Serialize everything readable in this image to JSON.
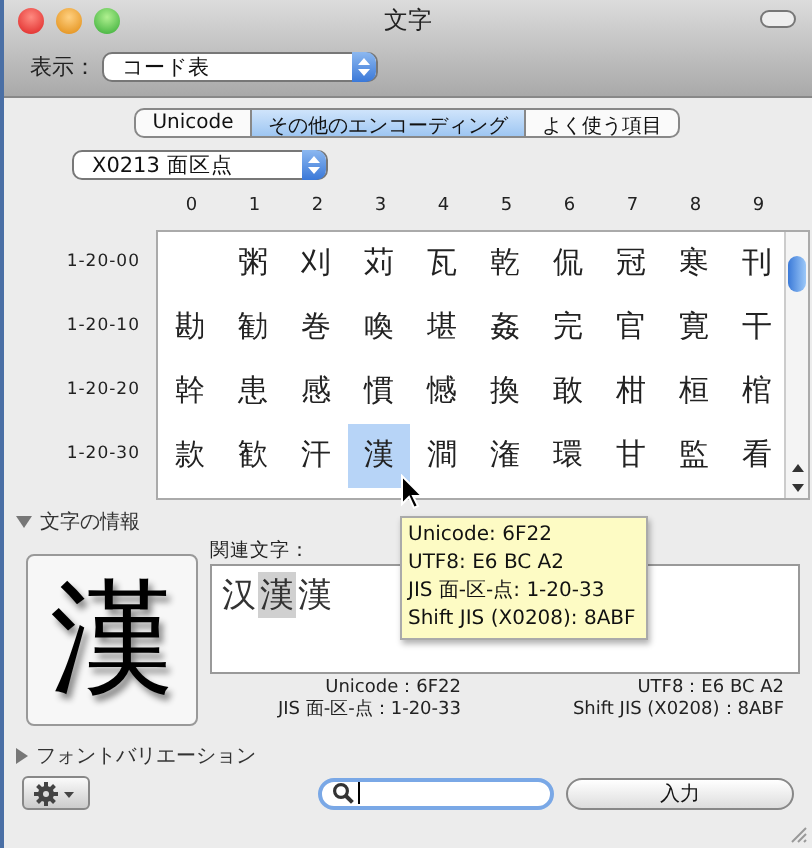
{
  "window": {
    "title": "文字"
  },
  "view": {
    "label": "表示：",
    "value": "コード表"
  },
  "tabs": [
    {
      "label": "Unicode",
      "selected": false
    },
    {
      "label": "その他のエンコーディング",
      "selected": true
    },
    {
      "label": "よく使う項目",
      "selected": false
    }
  ],
  "encoding": {
    "value": "X0213 面区点"
  },
  "grid": {
    "columns": [
      "0",
      "1",
      "2",
      "3",
      "4",
      "5",
      "6",
      "7",
      "8",
      "9"
    ],
    "rows": [
      {
        "label": "1-20-00",
        "cells": [
          {
            "selected": false
          },
          {
            "char": "粥",
            "selected": false
          },
          {
            "char": "刈",
            "selected": false
          },
          {
            "char": "苅",
            "selected": false
          },
          {
            "char": "瓦",
            "selected": false
          },
          {
            "char": "乾",
            "selected": false
          },
          {
            "char": "侃",
            "selected": false
          },
          {
            "char": "冠",
            "selected": false
          },
          {
            "char": "寒",
            "selected": false
          },
          {
            "char": "刊",
            "selected": false
          }
        ]
      },
      {
        "label": "1-20-10",
        "cells": [
          {
            "char": "勘",
            "selected": false
          },
          {
            "char": "勧",
            "selected": false
          },
          {
            "char": "巻",
            "selected": false
          },
          {
            "char": "喚",
            "selected": false
          },
          {
            "char": "堪",
            "selected": false
          },
          {
            "char": "姦",
            "selected": false
          },
          {
            "char": "完",
            "selected": false
          },
          {
            "char": "官",
            "selected": false
          },
          {
            "char": "寛",
            "selected": false
          },
          {
            "char": "干",
            "selected": false
          }
        ]
      },
      {
        "label": "1-20-20",
        "cells": [
          {
            "char": "幹",
            "selected": false
          },
          {
            "char": "患",
            "selected": false
          },
          {
            "char": "感",
            "selected": false
          },
          {
            "char": "慣",
            "selected": false
          },
          {
            "char": "憾",
            "selected": false
          },
          {
            "char": "換",
            "selected": false
          },
          {
            "char": "敢",
            "selected": false
          },
          {
            "char": "柑",
            "selected": false
          },
          {
            "char": "桓",
            "selected": false
          },
          {
            "char": "棺",
            "selected": false
          }
        ]
      },
      {
        "label": "1-20-30",
        "cells": [
          {
            "char": "款",
            "selected": false
          },
          {
            "char": "歓",
            "selected": false
          },
          {
            "char": "汗",
            "selected": false
          },
          {
            "char": "漢",
            "selected": true
          },
          {
            "char": "澗",
            "selected": false
          },
          {
            "char": "潅",
            "selected": false
          },
          {
            "char": "環",
            "selected": false
          },
          {
            "char": "甘",
            "selected": false
          },
          {
            "char": "監",
            "selected": false
          },
          {
            "char": "看",
            "selected": false
          }
        ]
      }
    ]
  },
  "tooltip": [
    "Unicode: 6F22",
    "UTF8: E6 BC A2",
    "JIS 面-区-点: 1-20-33",
    "Shift JIS (X0208): 8ABF"
  ],
  "info": {
    "title": "文字の情報",
    "expanded": true,
    "preview": "漢",
    "related_label": "関連文字：",
    "related": [
      {
        "char": "汉",
        "selected": false
      },
      {
        "char": "漢",
        "selected": true
      },
      {
        "char": "漢",
        "selected": false
      }
    ],
    "codes": [
      "Unicode：6F22",
      "UTF8：E6 BC A2",
      "JIS 面-区-点：1-20-33",
      "Shift JIS (X0208)：8ABF"
    ]
  },
  "font_variation": {
    "title": "フォントバリエーション",
    "expanded": false
  },
  "insert_button": "入力"
}
